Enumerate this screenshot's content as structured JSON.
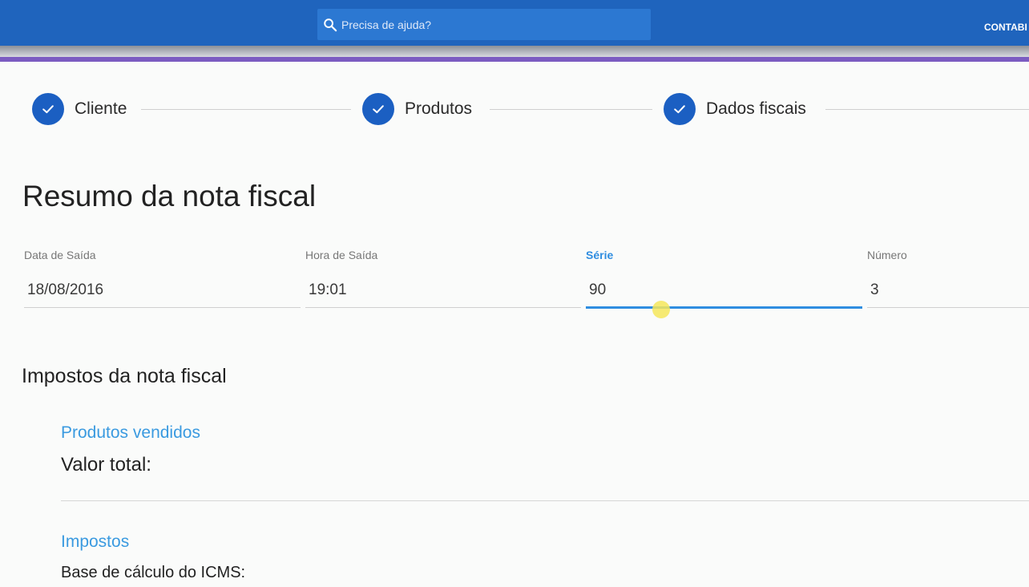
{
  "header": {
    "search_placeholder": "Precisa de ajuda?",
    "search_icon": "search-icon",
    "right_link": "CONTABI",
    "colors": {
      "bar": "#1f64bd",
      "accent": "#7b5cc1"
    }
  },
  "steps": [
    {
      "label": "Cliente",
      "icon": "check-icon",
      "status": "completed"
    },
    {
      "label": "Produtos",
      "icon": "check-icon",
      "status": "completed"
    },
    {
      "label": "Dados fiscais",
      "icon": "check-icon",
      "status": "completed"
    }
  ],
  "summary": {
    "title": "Resumo da nota fiscal",
    "fields": [
      {
        "label": "Data de Saída",
        "value": "18/08/2016"
      },
      {
        "label": "Hora de Saída",
        "value": "19:01"
      },
      {
        "label": "Série",
        "value": "90",
        "focused": true
      },
      {
        "label": "Número",
        "value": "3"
      }
    ]
  },
  "taxes": {
    "title": "Impostos da nota fiscal",
    "products_heading": "Produtos vendidos",
    "total_label": "Valor total:",
    "taxes_heading": "Impostos",
    "icms_base_label": "Base de cálculo do ICMS:"
  },
  "colors": {
    "step_circle": "#1b5fc2",
    "focus": "#2f8de0",
    "heading_link": "#3a9ae0"
  }
}
